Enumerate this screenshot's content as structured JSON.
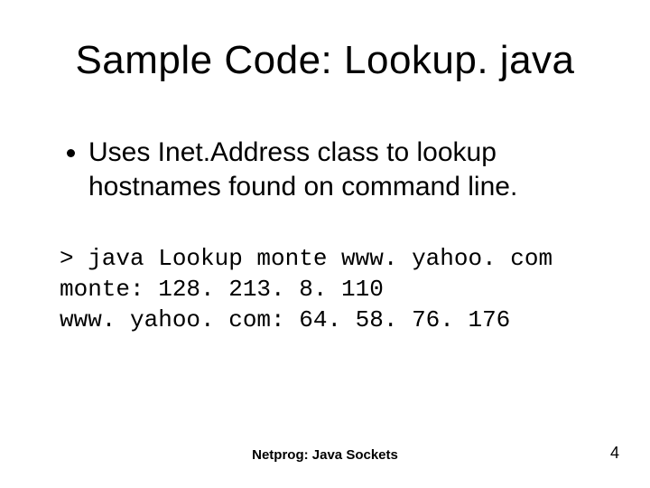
{
  "title": "Sample Code: Lookup. java",
  "bullet": {
    "line": "Uses Inet.Address class to lookup hostnames found on command line."
  },
  "code": {
    "line1": "> java Lookup monte www. yahoo. com",
    "line2": "monte: 128. 213. 8. 110",
    "line3": "www. yahoo. com: 64. 58. 76. 176"
  },
  "footer": {
    "center": "Netprog: Java Sockets",
    "page": "4"
  }
}
